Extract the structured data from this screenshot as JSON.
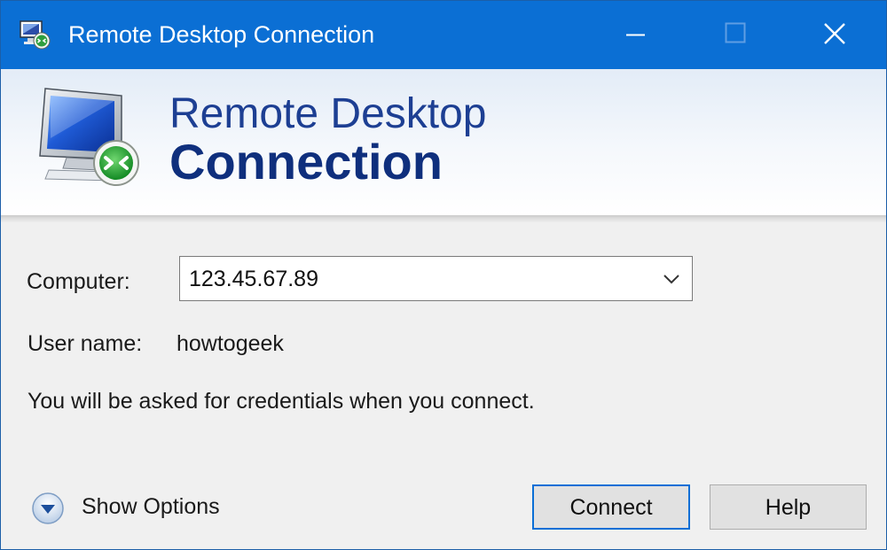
{
  "window": {
    "title": "Remote Desktop Connection",
    "title_icon": "remote-desktop-icon"
  },
  "title_controls": {
    "minimize_icon": "minimize-icon",
    "maximize_icon": "maximize-icon",
    "close_icon": "close-icon"
  },
  "banner": {
    "line1": "Remote Desktop",
    "line2": "Connection",
    "logo_icon": "monitor-connection-icon"
  },
  "form": {
    "computer_label": "Computer:",
    "computer_value": "123.45.67.89",
    "computer_dropdown_icon": "chevron-down-icon",
    "username_label": "User name:",
    "username_value": "howtogeek",
    "info_text": "You will be asked for credentials when you connect."
  },
  "footer": {
    "show_options_label": "Show Options",
    "show_options_icon": "expand-down-icon",
    "connect_label": "Connect",
    "help_label": "Help"
  },
  "colors": {
    "titlebar": "#0b6fd4",
    "banner_text": "#1d3f93",
    "banner_text_bold": "#0f2f7d",
    "default_button_border": "#0a6fd6",
    "window_background": "#f0f0f0"
  }
}
